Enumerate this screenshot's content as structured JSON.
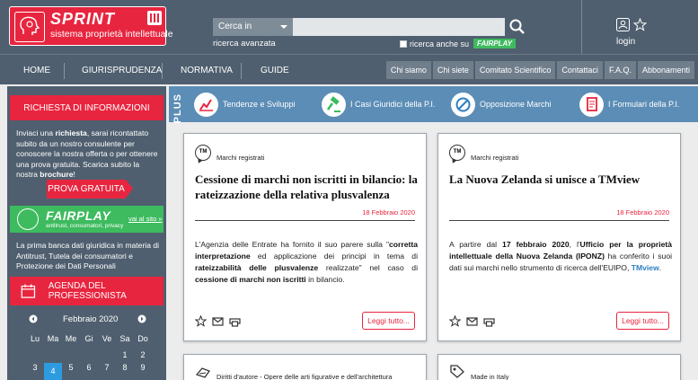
{
  "header": {
    "logo_title": "SPRINT",
    "logo_subtitle": "sistema proprietà intellettuale",
    "search_select": "Cerca in",
    "advanced_search": "ricerca avanzata",
    "fairplay_check_label": "ricerca anche su",
    "fairplay_badge": "FAIRPLAY",
    "login": "login"
  },
  "nav": {
    "left": [
      "HOME",
      "GIURISPRUDENZA",
      "NORMATIVA",
      "GUIDE"
    ],
    "right": [
      "Chi siamo",
      "Chi siete",
      "Comitato Scientifico",
      "Contattaci",
      "F.A.Q.",
      "Abbonamenti"
    ]
  },
  "sidebar": {
    "info_heading": "RICHIESTA DI INFORMAZIONI",
    "info_text_1": "Inviaci una ",
    "info_text_bold": "richiesta",
    "info_text_2": ", sarai ricontattato subito da un nostro consulente per conoscere la nostra offerta o per ottenere una prova gratuita. Scarica subito la nostra ",
    "info_text_bold2": "brochure",
    "info_text_3": "!",
    "trial_button": "PROVA GRATUITA",
    "fairplay_title": "FAIRPLAY",
    "fairplay_sub": "antitrust, consumatori, privacy",
    "fairplay_link": "vai al sito »",
    "fairplay_text": "La prima banca dati giuridica in materia di Antitrust, Tutela dei consumatori e Protezione dei Dati Personali",
    "agenda_heading": "AGENDA DEL PROFESSIONISTA",
    "calendar": {
      "month": "Febbraio 2020",
      "weekdays": [
        "Lu",
        "Ma",
        "Me",
        "Gi",
        "Ve",
        "Sa",
        "Do"
      ],
      "week1": [
        "",
        "",
        "",
        "",
        "",
        "1",
        "2"
      ],
      "week2": [
        "3",
        "4",
        "5",
        "6",
        "7",
        "8",
        "9"
      ]
    }
  },
  "plus": {
    "label": "PLUS",
    "items": [
      "Tendenze e Sviluppi",
      "I Casi Giuridici della P.I.",
      "Opposizione Marchi",
      "I Formulari della P.I."
    ]
  },
  "cards": [
    {
      "category": "Marchi registrati",
      "title": "Cessione di marchi non iscritti in bilancio: la rateizzazione della relativa plusvalenza",
      "date": "18 Febbraio 2020",
      "body": [
        {
          "t": "L'Agenzia delle Entrate ha fornito il suo parere sulla \"",
          "b": false
        },
        {
          "t": "corretta interpretazione",
          "b": true
        },
        {
          "t": " ed applicazione dei principi in tema di ",
          "b": false
        },
        {
          "t": "rateizzabilità delle plusvalenze",
          "b": true
        },
        {
          "t": " realizzate\" nel caso di ",
          "b": false
        },
        {
          "t": "cessione di marchi non iscritti",
          "b": true
        },
        {
          "t": " in bilancio.",
          "b": false
        }
      ],
      "read_more": "Leggi tutto..."
    },
    {
      "category": "Marchi registrati",
      "title": "La Nuova Zelanda si unisce a TMview",
      "date": "18 Febbraio 2020",
      "body": [
        {
          "t": "A partire dal ",
          "b": false
        },
        {
          "t": "17 febbraio 2020",
          "b": true
        },
        {
          "t": ", l'",
          "b": false
        },
        {
          "t": "Ufficio per la proprietà intellettuale della Nuova Zelanda (IPONZ)",
          "b": true
        },
        {
          "t": " ha conferito i suoi dati sui marchi nello strumento di ricerca dell'EUIPO, ",
          "b": false
        },
        {
          "t": "TMview",
          "b": true,
          "link": true
        },
        {
          "t": ".",
          "b": false
        }
      ],
      "read_more": "Leggi tutto..."
    }
  ],
  "bottom_cards": [
    "Diritti d'autore - Opere delle arti figurative e dell'architettura",
    "Made in Italy"
  ],
  "colors": {
    "red": "#e8253f",
    "slate": "#4f5f6f",
    "blue": "#5b8db6",
    "green": "#3dbb5e"
  }
}
